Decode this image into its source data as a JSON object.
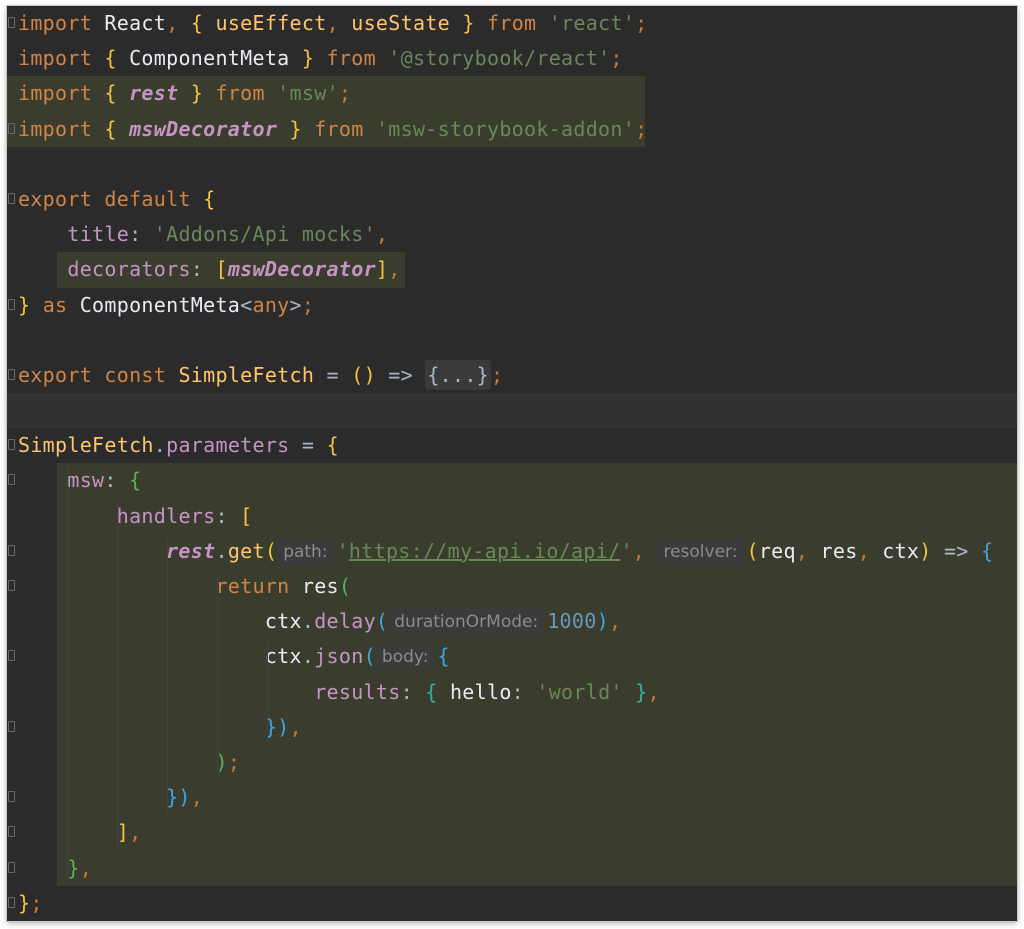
{
  "editor": {
    "lines": [
      {
        "tokens": [
          [
            "kw",
            "import"
          ],
          [
            "plain",
            " "
          ],
          [
            "ident",
            "React"
          ],
          [
            "punct",
            ", "
          ],
          [
            "brace-y",
            "{ "
          ],
          [
            "fn",
            "useEffect"
          ],
          [
            "punct",
            ", "
          ],
          [
            "fn",
            "useState"
          ],
          [
            "brace-y",
            " }"
          ],
          [
            "plain",
            " "
          ],
          [
            "kw",
            "from"
          ],
          [
            "plain",
            " "
          ],
          [
            "str",
            "'react'"
          ],
          [
            "punct",
            ";"
          ]
        ]
      },
      {
        "tokens": [
          [
            "kw",
            "import"
          ],
          [
            "plain",
            " "
          ],
          [
            "brace-y",
            "{ "
          ],
          [
            "ident",
            "ComponentMeta"
          ],
          [
            "brace-y",
            " }"
          ],
          [
            "plain",
            " "
          ],
          [
            "kw",
            "from"
          ],
          [
            "plain",
            " "
          ],
          [
            "str",
            "'@storybook/react'"
          ],
          [
            "punct",
            ";"
          ]
        ]
      },
      {
        "tokens": [
          [
            "kw",
            "import"
          ],
          [
            "plain",
            " "
          ],
          [
            "brace-y",
            "{ "
          ],
          [
            "italicprop",
            "rest"
          ],
          [
            "brace-y",
            " }"
          ],
          [
            "plain",
            " "
          ],
          [
            "kw",
            "from"
          ],
          [
            "plain",
            " "
          ],
          [
            "str",
            "'msw'"
          ],
          [
            "punct",
            ";"
          ]
        ]
      },
      {
        "tokens": [
          [
            "kw",
            "import"
          ],
          [
            "plain",
            " "
          ],
          [
            "brace-y",
            "{ "
          ],
          [
            "italicprop",
            "mswDecorator"
          ],
          [
            "brace-y",
            " }"
          ],
          [
            "plain",
            " "
          ],
          [
            "kw",
            "from"
          ],
          [
            "plain",
            " "
          ],
          [
            "str",
            "'msw-storybook-addon'"
          ],
          [
            "punct",
            ";"
          ]
        ]
      },
      {
        "tokens": []
      },
      {
        "tokens": [
          [
            "kw",
            "export"
          ],
          [
            "plain",
            " "
          ],
          [
            "kw",
            "default"
          ],
          [
            "plain",
            " "
          ],
          [
            "brace-y",
            "{"
          ]
        ]
      },
      {
        "tokens": [
          [
            "plain",
            "    "
          ],
          [
            "prop",
            "title"
          ],
          [
            "plain",
            ": "
          ],
          [
            "str",
            "'Addons/Api mocks'"
          ],
          [
            "punct",
            ","
          ]
        ]
      },
      {
        "tokens": [
          [
            "plain",
            "    "
          ],
          [
            "prop",
            "decorators"
          ],
          [
            "plain",
            ": "
          ],
          [
            "brace-y",
            "["
          ],
          [
            "italicprop",
            "mswDecorator"
          ],
          [
            "brace-y",
            "]"
          ],
          [
            "punct",
            ","
          ]
        ]
      },
      {
        "tokens": [
          [
            "brace-y",
            "}"
          ],
          [
            "plain",
            " "
          ],
          [
            "kw",
            "as"
          ],
          [
            "plain",
            " "
          ],
          [
            "ident",
            "ComponentMeta"
          ],
          [
            "plain",
            "<"
          ],
          [
            "kw",
            "any"
          ],
          [
            "plain",
            ">"
          ],
          [
            "punct",
            ";"
          ]
        ]
      },
      {
        "tokens": []
      },
      {
        "tokens": [
          [
            "kw",
            "export"
          ],
          [
            "plain",
            " "
          ],
          [
            "kw",
            "const"
          ],
          [
            "plain",
            " "
          ],
          [
            "fn",
            "SimpleFetch"
          ],
          [
            "plain",
            " = "
          ],
          [
            "brace-y",
            "()"
          ],
          [
            "plain",
            " => "
          ],
          [
            "collapsed",
            "{...}"
          ],
          [
            "punct",
            ";"
          ]
        ]
      },
      {
        "tokens": []
      },
      {
        "tokens": [
          [
            "fn",
            "SimpleFetch"
          ],
          [
            "plain",
            "."
          ],
          [
            "prop",
            "parameters"
          ],
          [
            "plain",
            " = "
          ],
          [
            "brace-y",
            "{"
          ]
        ]
      },
      {
        "tokens": [
          [
            "plain",
            "    "
          ],
          [
            "prop",
            "msw"
          ],
          [
            "plain",
            ": "
          ],
          [
            "brace-g",
            "{"
          ]
        ]
      },
      {
        "tokens": [
          [
            "plain",
            "        "
          ],
          [
            "prop",
            "handlers"
          ],
          [
            "plain",
            ": "
          ],
          [
            "brace-y",
            "["
          ]
        ]
      },
      {
        "tokens": [
          [
            "plain",
            "            "
          ],
          [
            "italicprop",
            "rest"
          ],
          [
            "plain",
            "."
          ],
          [
            "fn",
            "get"
          ],
          [
            "brace-y",
            "("
          ],
          [
            "hint",
            "path:"
          ],
          [
            "str",
            "'"
          ],
          [
            "link",
            "https://my-api.io/api/"
          ],
          [
            "str",
            "'"
          ],
          [
            "punct",
            ", "
          ],
          [
            "hint",
            "resolver:"
          ],
          [
            "brace-y",
            "("
          ],
          [
            "ident",
            "req"
          ],
          [
            "punct",
            ", "
          ],
          [
            "ident",
            "res"
          ],
          [
            "punct",
            ", "
          ],
          [
            "ident",
            "ctx"
          ],
          [
            "brace-y",
            ")"
          ],
          [
            "plain",
            " => "
          ],
          [
            "brace-b",
            "{"
          ]
        ]
      },
      {
        "tokens": [
          [
            "plain",
            "                "
          ],
          [
            "kw",
            "return"
          ],
          [
            "plain",
            " "
          ],
          [
            "ident",
            "res"
          ],
          [
            "brace-g",
            "("
          ]
        ]
      },
      {
        "tokens": [
          [
            "plain",
            "                    "
          ],
          [
            "ident",
            "ctx"
          ],
          [
            "plain",
            "."
          ],
          [
            "prop",
            "delay"
          ],
          [
            "brace-b",
            "("
          ],
          [
            "hint",
            "durationOrMode:"
          ],
          [
            "num",
            "1000"
          ],
          [
            "brace-b",
            ")"
          ],
          [
            "punct",
            ","
          ]
        ]
      },
      {
        "tokens": [
          [
            "plain",
            "                    "
          ],
          [
            "ident",
            "ctx"
          ],
          [
            "plain",
            "."
          ],
          [
            "prop",
            "json"
          ],
          [
            "brace-b",
            "("
          ],
          [
            "hint",
            "body:"
          ],
          [
            "brace-b",
            "{"
          ]
        ]
      },
      {
        "tokens": [
          [
            "plain",
            "                        "
          ],
          [
            "prop",
            "results"
          ],
          [
            "plain",
            ": "
          ],
          [
            "brace-t",
            "{ "
          ],
          [
            "ident",
            "hello"
          ],
          [
            "plain",
            ": "
          ],
          [
            "str",
            "'world'"
          ],
          [
            "brace-t",
            " }"
          ],
          [
            "punct",
            ","
          ]
        ]
      },
      {
        "tokens": [
          [
            "plain",
            "                    "
          ],
          [
            "brace-b",
            "})"
          ],
          [
            "punct",
            ","
          ]
        ]
      },
      {
        "tokens": [
          [
            "plain",
            "                "
          ],
          [
            "brace-g",
            ")"
          ],
          [
            "punct",
            ";"
          ]
        ]
      },
      {
        "tokens": [
          [
            "plain",
            "            "
          ],
          [
            "brace-b",
            "})"
          ],
          [
            "punct",
            ","
          ]
        ]
      },
      {
        "tokens": [
          [
            "plain",
            "        "
          ],
          [
            "brace-y",
            "]"
          ],
          [
            "punct",
            ","
          ]
        ]
      },
      {
        "tokens": [
          [
            "plain",
            "    "
          ],
          [
            "brace-g",
            "}"
          ],
          [
            "punct",
            ","
          ]
        ]
      },
      {
        "tokens": [
          [
            "brace-y",
            "}"
          ],
          [
            "punct",
            ";"
          ]
        ]
      }
    ]
  }
}
